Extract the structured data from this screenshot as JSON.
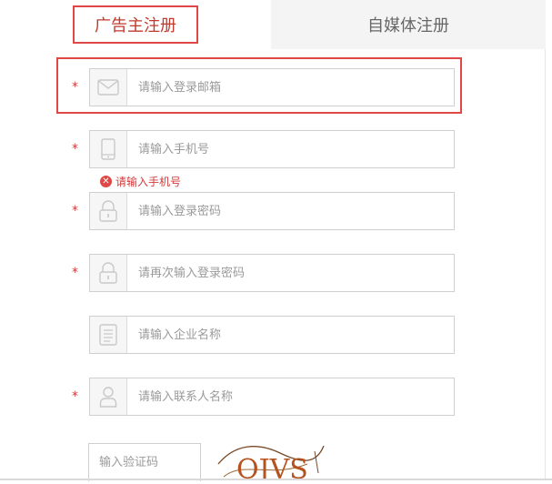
{
  "tabs": [
    {
      "label": "广告主注册"
    },
    {
      "label": "自媒体注册"
    }
  ],
  "form": {
    "email": {
      "required_mark": "*",
      "placeholder": "请输入登录邮箱"
    },
    "phone": {
      "required_mark": "*",
      "placeholder": "请输入手机号",
      "error": "请输入手机号"
    },
    "password": {
      "required_mark": "*",
      "placeholder": "请输入登录密码"
    },
    "password_confirm": {
      "required_mark": "*",
      "placeholder": "请再次输入登录密码"
    },
    "company": {
      "placeholder": "请输入企业名称"
    },
    "contact": {
      "required_mark": "*",
      "placeholder": "请输入联系人名称"
    },
    "captcha": {
      "placeholder": "输入验证码",
      "image_text": "OJVS"
    }
  },
  "colors": {
    "accent": "#e04848",
    "error": "#d23b3b"
  },
  "icons": [
    "envelope-icon",
    "phone-icon",
    "lock-icon",
    "lock-icon",
    "document-icon",
    "user-icon",
    "error-x-icon"
  ]
}
